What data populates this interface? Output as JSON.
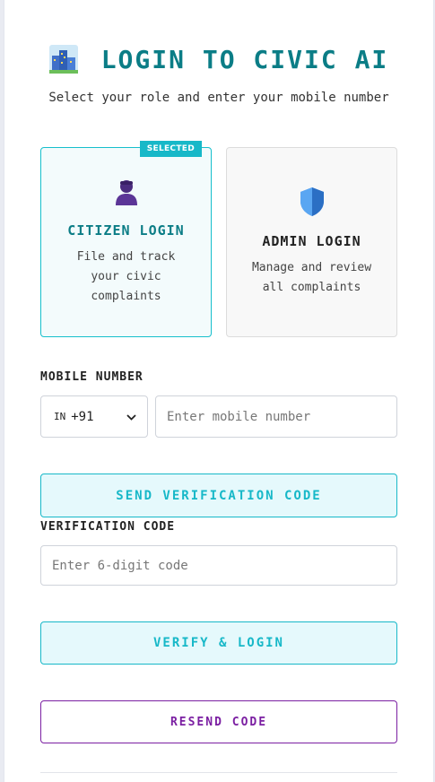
{
  "header": {
    "title": "LOGIN TO CIVIC AI",
    "subtitle": "Select your role and enter your mobile number",
    "logo_icon": "city-buildings-icon"
  },
  "roles": {
    "citizen": {
      "title": "CITIZEN LOGIN",
      "description": "File and track your civic complaints",
      "badge": "SELECTED",
      "icon": "person-icon",
      "selected": true
    },
    "admin": {
      "title": "ADMIN LOGIN",
      "description": "Manage and review all complaints",
      "icon": "shield-icon",
      "selected": false
    }
  },
  "mobile": {
    "label": "MOBILE NUMBER",
    "country_code": "IN",
    "dial_code": "+91",
    "placeholder": "Enter mobile number",
    "value": ""
  },
  "buttons": {
    "send_code": "SEND VERIFICATION CODE",
    "verify": "VERIFY & LOGIN",
    "resend": "RESEND CODE"
  },
  "verification": {
    "label": "VERIFICATION CODE",
    "placeholder": "Enter 6-digit code",
    "value": ""
  },
  "colors": {
    "accent": "#17b8c8",
    "title": "#0b7d86",
    "secondary": "#7b1fa2"
  }
}
